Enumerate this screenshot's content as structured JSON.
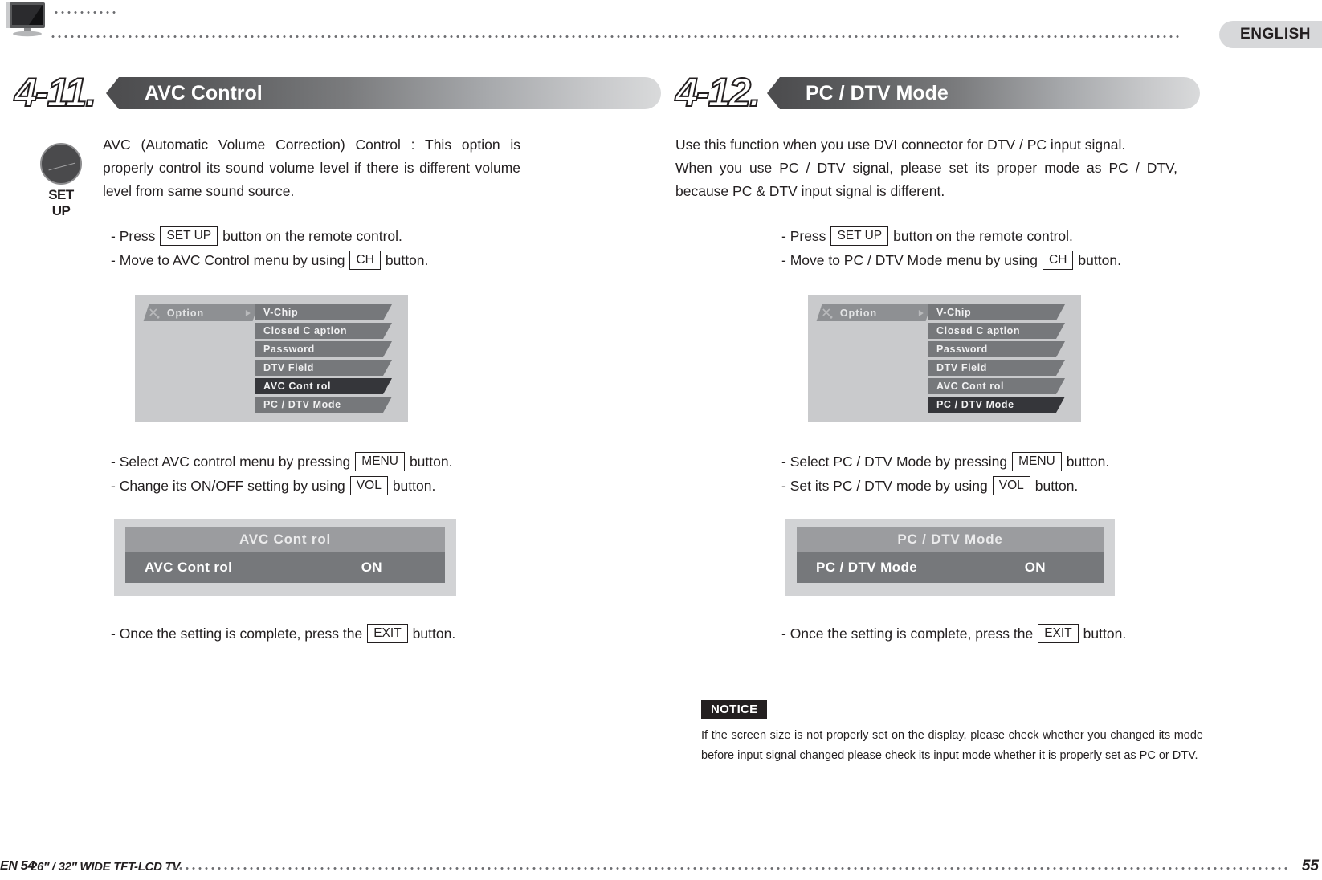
{
  "header": {
    "language_tab": "ENGLISH",
    "tv_icon": "tv-icon"
  },
  "left_page": {
    "section_number": "4-11.",
    "section_title": "AVC Control",
    "knob": {
      "icon": "setup-knob-icon",
      "label": "SET UP"
    },
    "intro": "AVC (Automatic Volume Correction) Control : This option is properly control its sound volume level if there is different volume level from same sound source.",
    "steps_group_1": [
      {
        "pre": "- Press",
        "key": "SET UP",
        "post": "button on the remote control."
      },
      {
        "pre": "- Move to AVC Control menu by using",
        "key": "CH",
        "post": "button."
      }
    ],
    "osd": {
      "tab_label": "Option",
      "items": [
        {
          "label": "V-Chip",
          "selected": false
        },
        {
          "label": "Closed C aption",
          "selected": false
        },
        {
          "label": "Password",
          "selected": false
        },
        {
          "label": "DTV  Field",
          "selected": false
        },
        {
          "label": "AVC Cont rol",
          "selected": true
        },
        {
          "label": "PC / DTV Mode",
          "selected": false
        }
      ]
    },
    "steps_group_2": [
      {
        "pre": "- Select AVC control menu by pressing",
        "key": "MENU",
        "post": "button."
      },
      {
        "pre": "- Change its ON/OFF setting by using",
        "key": "VOL",
        "post": "button."
      }
    ],
    "setbox": {
      "title": "AVC Cont rol",
      "row_key": "AVC Cont rol",
      "row_value": "ON"
    },
    "steps_group_3": [
      {
        "pre": "- Once the setting is complete, press the",
        "key": "EXIT",
        "post": "button."
      }
    ]
  },
  "right_page": {
    "section_number": "4-12.",
    "section_title": "PC / DTV Mode",
    "intro_line_1": "Use this function when you use DVI connector for DTV / PC input signal.",
    "intro_line_2": "When you use PC / DTV signal, please set its proper mode as PC / DTV, because PC & DTV input signal is different.",
    "steps_group_1": [
      {
        "pre": "- Press",
        "key": "SET UP",
        "post": "button on the remote control."
      },
      {
        "pre": "- Move to PC / DTV Mode menu by using",
        "key": "CH",
        "post": "button."
      }
    ],
    "osd": {
      "tab_label": "Option",
      "items": [
        {
          "label": "V-Chip",
          "selected": false
        },
        {
          "label": "Closed C aption",
          "selected": false
        },
        {
          "label": "Password",
          "selected": false
        },
        {
          "label": "DTV  Field",
          "selected": false
        },
        {
          "label": "AVC Cont rol",
          "selected": false
        },
        {
          "label": "PC / DTV Mode",
          "selected": true
        }
      ]
    },
    "steps_group_2": [
      {
        "pre": "- Select PC / DTV Mode by pressing",
        "key": "MENU",
        "post": "button."
      },
      {
        "pre": "- Set its PC / DTV mode by using",
        "key": "VOL",
        "post": "button."
      }
    ],
    "setbox": {
      "title": "PC / DTV Mode",
      "row_key": "PC / DTV Mode",
      "row_value": "ON"
    },
    "steps_group_3": [
      {
        "pre": "- Once the setting is complete, press the",
        "key": "EXIT",
        "post": "button."
      }
    ],
    "notice": {
      "tag": "NOTICE",
      "body": "If the screen size is not properly set on the display, please check whether you changed its mode before input signal changed please check its input mode whether it is properly set as PC or DTV."
    }
  },
  "footer": {
    "left_page_label": "EN 54",
    "model": "26″ / 32″ WIDE TFT-LCD TV",
    "right_page_number": "55"
  }
}
